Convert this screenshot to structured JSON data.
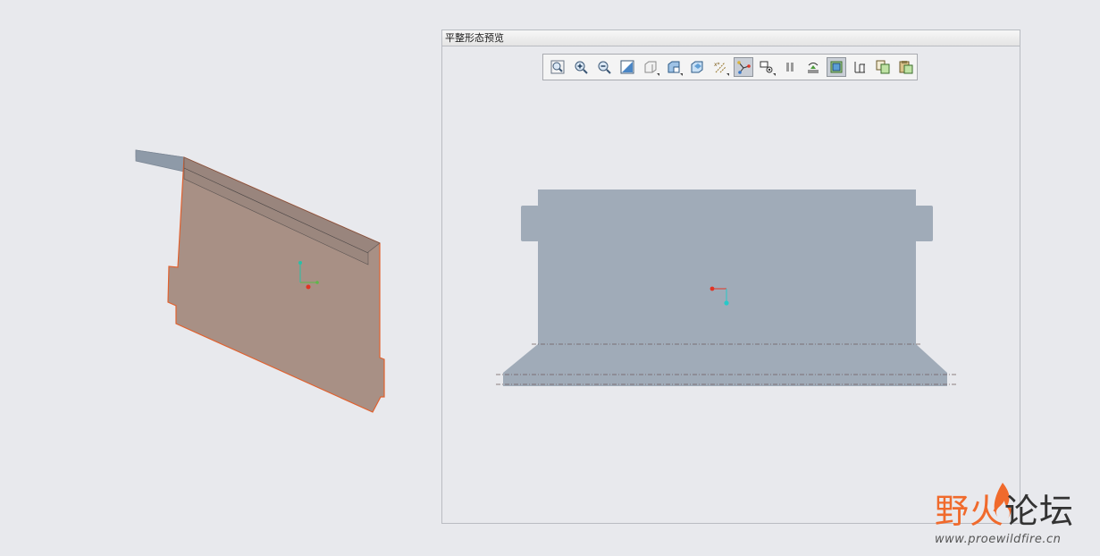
{
  "preview": {
    "title": "平整形态预览",
    "toolbar": [
      {
        "name": "refit-icon",
        "active": false
      },
      {
        "name": "zoom-in-icon",
        "active": false
      },
      {
        "name": "zoom-out-icon",
        "active": false
      },
      {
        "name": "repaint-icon",
        "active": false
      },
      {
        "name": "saved-orientations-icon",
        "active": false,
        "dropdown": true
      },
      {
        "name": "display-style-icon",
        "active": false,
        "dropdown": true
      },
      {
        "name": "view-manager-icon",
        "active": false
      },
      {
        "name": "datum-display-icon",
        "active": false,
        "dropdown": true
      },
      {
        "name": "csys-display-icon",
        "active": true
      },
      {
        "name": "annotation-display-icon",
        "active": false,
        "dropdown": true
      },
      {
        "name": "pause-icon",
        "active": false
      },
      {
        "name": "spin-center-icon",
        "active": false
      },
      {
        "name": "bend-lines-icon",
        "active": true
      },
      {
        "name": "dimension-icon",
        "active": false
      },
      {
        "name": "copy-icon",
        "active": false
      },
      {
        "name": "paste-icon",
        "active": false
      }
    ]
  },
  "watermark": {
    "brand_part1": "野火",
    "brand_part2": "论坛",
    "url": "www.proewildfire.cn"
  },
  "colors": {
    "part_fill": "#a48b80",
    "part_edge": "#e0612f",
    "flange": "#9da8b6",
    "flat_fill": "#a0abb8",
    "background": "#e8e9ed"
  }
}
